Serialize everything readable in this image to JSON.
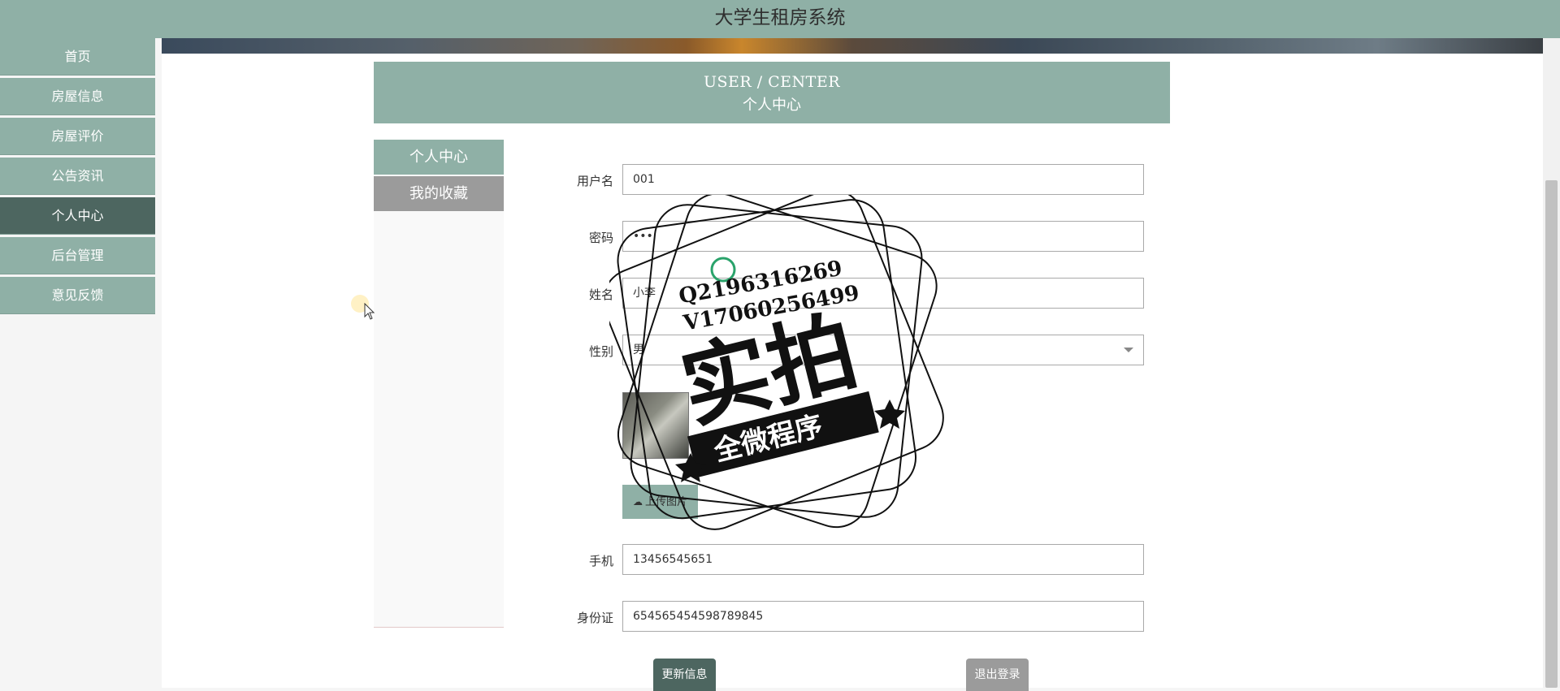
{
  "app": {
    "title": "大学生租房系统"
  },
  "sidebar": {
    "items": [
      {
        "label": "首页",
        "active": false
      },
      {
        "label": "房屋信息",
        "active": false
      },
      {
        "label": "房屋评价",
        "active": false
      },
      {
        "label": "公告资讯",
        "active": false
      },
      {
        "label": "个人中心",
        "active": true
      },
      {
        "label": "后台管理",
        "active": false
      },
      {
        "label": "意见反馈",
        "active": false
      }
    ]
  },
  "user_center": {
    "title_en": "USER / CENTER",
    "title_cn": "个人中心",
    "subnav": [
      {
        "label": "个人中心",
        "active": true
      },
      {
        "label": "我的收藏",
        "active": false
      }
    ]
  },
  "form": {
    "username": {
      "label": "用户名",
      "value": "001"
    },
    "password": {
      "label": "密码",
      "value": "•••"
    },
    "name": {
      "label": "姓名",
      "value": "小李"
    },
    "gender": {
      "label": "性别",
      "value": "男"
    },
    "upload_label": "上传图片",
    "phone": {
      "label": "手机",
      "value": "13456545651"
    },
    "id_card": {
      "label": "身份证",
      "value": "654565454598789845"
    },
    "update_label": "更新信息",
    "logout_label": "退出登录"
  },
  "watermark": {
    "line1": "Q2196316269",
    "line2": "V17060256499",
    "big": "实拍",
    "ribbon": "全微程序"
  },
  "colors": {
    "accent": "#8fb0a6",
    "active": "#4d6660",
    "neutral": "#9b9b9b"
  }
}
